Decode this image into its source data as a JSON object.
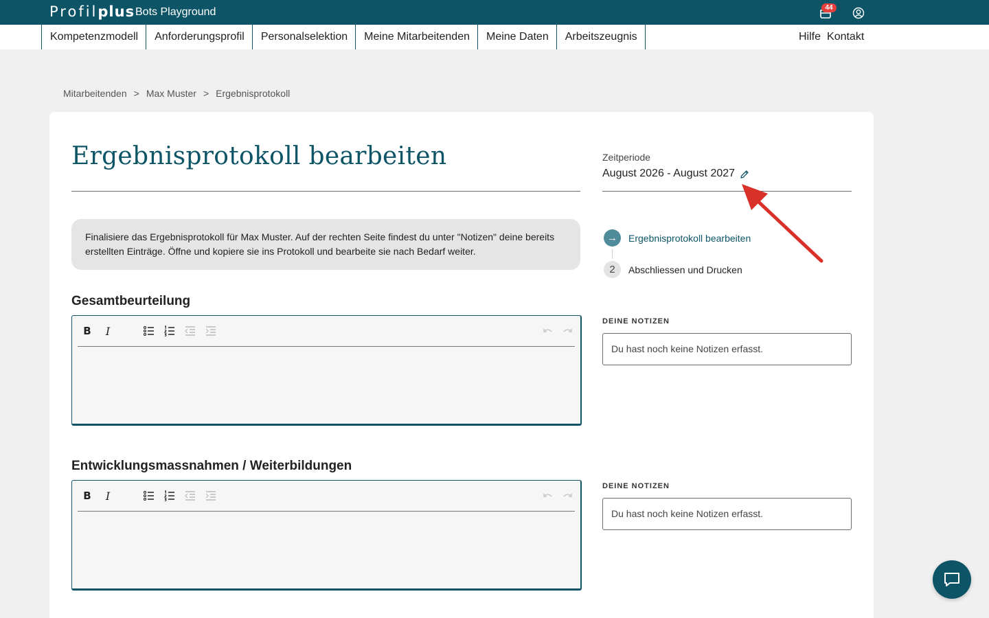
{
  "header": {
    "logo_light": "Profil",
    "logo_bold": "plus",
    "org_name": "Bots Playground",
    "cart_count": "44"
  },
  "nav": {
    "items": [
      "Kompetenzmodell",
      "Anforderungsprofil",
      "Personalselektion",
      "Meine Mitarbeitenden",
      "Meine Daten",
      "Arbeitszeugnis"
    ],
    "help": "Hilfe",
    "contact": "Kontakt"
  },
  "breadcrumb": {
    "items": [
      "Mitarbeitenden",
      "Max Muster",
      "Ergebnisprotokoll"
    ],
    "separator": ">"
  },
  "page": {
    "title": "Ergebnisprotokoll bearbeiten",
    "period_label": "Zeitperiode",
    "period_value": "August 2026 - August 2027",
    "info_text": "Finalisiere das Ergebnisprotokoll für Max Muster. Auf der rechten Seite findest du unter \"Notizen\" deine bereits erstellten Einträge. Öffne und kopiere sie ins Protokoll und bearbeite sie nach Bedarf weiter."
  },
  "steps": [
    {
      "number": "→",
      "label": "Ergebnisprotokoll bearbeiten",
      "active": true
    },
    {
      "number": "2",
      "label": "Abschliessen und Drucken",
      "active": false
    }
  ],
  "sections": [
    {
      "title": "Gesamtbeurteilung",
      "notes_label": "DEINE NOTIZEN",
      "notes_text": "Du hast noch keine Notizen erfasst.",
      "editor_value": ""
    },
    {
      "title": "Entwicklungsmassnahmen / Weiterbildungen",
      "notes_label": "DEINE NOTIZEN",
      "notes_text": "Du hast noch keine Notizen erfasst.",
      "editor_value": ""
    }
  ],
  "toolbar": {
    "bold_label": "B",
    "italic_label": "I"
  },
  "colors": {
    "brand": "#0d5566",
    "badge": "#e7403c",
    "annotation_arrow": "#d9302a"
  }
}
